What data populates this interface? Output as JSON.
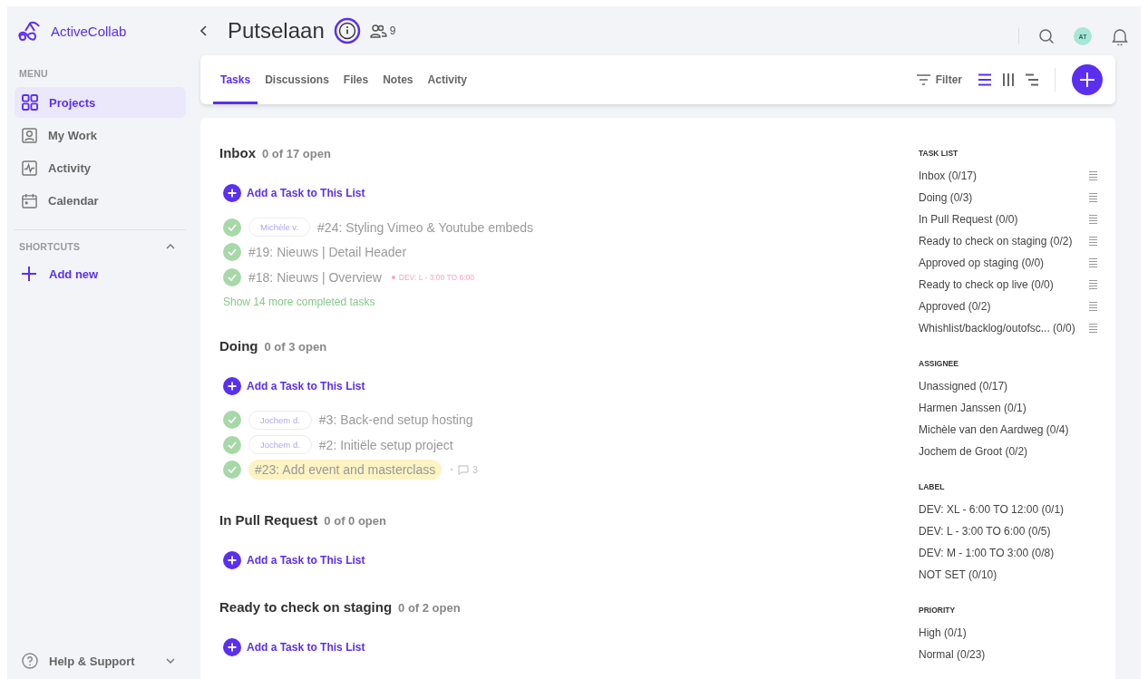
{
  "app": {
    "name": "ActiveCollab"
  },
  "sidebar": {
    "menu_heading": "MENU",
    "items": [
      {
        "label": "Projects",
        "kind": "grid",
        "selected": true
      },
      {
        "label": "My Work",
        "kind": "person",
        "selected": false
      },
      {
        "label": "Activity",
        "kind": "pulse",
        "selected": false
      },
      {
        "label": "Calendar",
        "kind": "calendar",
        "selected": false
      }
    ],
    "shortcuts": {
      "heading": "SHORTCUTS",
      "expanded": true,
      "add_label": "Add new"
    },
    "help": {
      "label": "Help & Support",
      "expanded": false
    }
  },
  "header": {
    "title": "Putselaan",
    "members": "9",
    "avatar": "AT"
  },
  "tabs": [
    {
      "label": "Tasks",
      "selected": true
    },
    {
      "label": "Discussions",
      "selected": false
    },
    {
      "label": "Files",
      "selected": false
    },
    {
      "label": "Notes",
      "selected": false
    },
    {
      "label": "Activity",
      "selected": false
    }
  ],
  "toolbar": {
    "filter": "Filter",
    "views": [
      {
        "kind": "list",
        "selected": true
      },
      {
        "kind": "columns",
        "selected": false
      },
      {
        "kind": "timeline",
        "selected": false
      }
    ]
  },
  "task_lists": [
    {
      "name": "Inbox",
      "count": "0 of 17 open",
      "add_label": "Add a Task to This List",
      "more": "Show 14 more completed tasks",
      "tasks": [
        {
          "assignee": "Michèle v.",
          "title": "#24: Styling Vimeo & Youtube embeds",
          "done": true,
          "highlighted": false
        },
        {
          "title": "#19: Nieuws | Detail Header",
          "done": true,
          "highlighted": false
        },
        {
          "title": "#18: Nieuws | Overview",
          "done": true,
          "highlighted": false,
          "label": {
            "text": "DEV: L - 3:00 TO 6:00",
            "color": "#f8a5c2"
          }
        }
      ]
    },
    {
      "name": "Doing",
      "count": "0 of 3 open",
      "add_label": "Add a Task to This List",
      "tasks": [
        {
          "assignee": "Jochem d.",
          "title": "#3: Back-end setup hosting",
          "done": true,
          "highlighted": false
        },
        {
          "assignee": "Jochem d.",
          "title": "#2: Initiële setup project",
          "done": true,
          "highlighted": false
        },
        {
          "title": "#23: Add event and masterclass",
          "done": true,
          "highlighted": true,
          "comments": "3"
        }
      ]
    },
    {
      "name": "In Pull Request",
      "count": "0 of 0 open",
      "add_label": "Add a Task to This List"
    },
    {
      "name": "Ready to check on staging",
      "count": "0 of 2 open",
      "add_label": "Add a Task to This List"
    }
  ],
  "side_panel": [
    {
      "heading": "TASK LIST",
      "reorderable": true,
      "items": [
        "Inbox (0/17)",
        "Doing (0/3)",
        "In Pull Request (0/0)",
        "Ready to check on staging (0/2)",
        "Approved op staging (0/0)",
        "Ready to check op live (0/0)",
        "Approved (0/2)",
        "Whishlist/backlog/outofsc... (0/0)"
      ]
    },
    {
      "heading": "ASSIGNEE",
      "reorderable": false,
      "items": [
        "Unassigned (0/17)",
        "Harmen Janssen (0/1)",
        "Michèle van den Aardweg (0/4)",
        "Jochem de Groot (0/2)"
      ]
    },
    {
      "heading": "LABEL",
      "reorderable": false,
      "items": [
        "DEV: XL - 6:00 TO 12:00 (0/1)",
        "DEV: L - 3:00 TO 6:00 (0/5)",
        "DEV: M - 1:00 TO 3:00 (0/8)",
        "NOT SET (0/10)"
      ]
    },
    {
      "heading": "PRIORITY",
      "reorderable": false,
      "items": [
        "High (0/1)",
        "Normal (0/23)"
      ]
    }
  ]
}
